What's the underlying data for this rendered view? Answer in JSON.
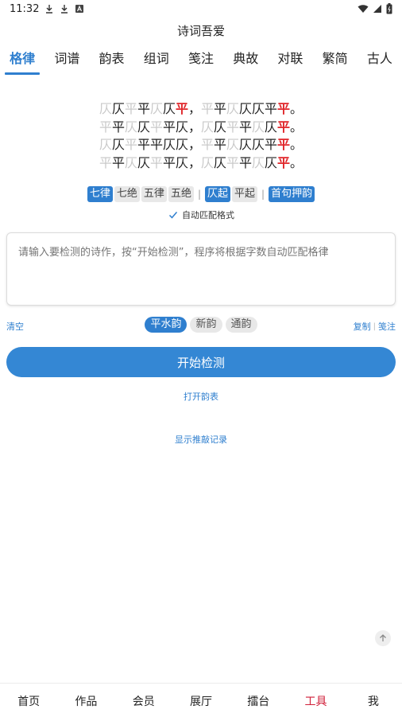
{
  "status_bar": {
    "time": "11:32",
    "icons": [
      "download-icon",
      "download-icon",
      "a-icon"
    ],
    "right_icons": [
      "wifi-icon",
      "signal-icon",
      "battery-icon"
    ]
  },
  "app": {
    "title": "诗词吾爱"
  },
  "tabs": [
    {
      "label": "格律",
      "active": true
    },
    {
      "label": "词谱"
    },
    {
      "label": "韵表"
    },
    {
      "label": "组词"
    },
    {
      "label": "笺注"
    },
    {
      "label": "典故"
    },
    {
      "label": "对联"
    },
    {
      "label": "繁简"
    },
    {
      "label": "古人"
    }
  ],
  "patterns": {
    "lines": [
      [
        [
          "仄",
          "f"
        ],
        [
          "仄",
          "d"
        ],
        [
          "平",
          "f"
        ],
        [
          "平",
          "d"
        ],
        [
          "仄",
          "f"
        ],
        [
          "仄",
          "d"
        ],
        [
          "平",
          "r"
        ],
        [
          "，",
          "p"
        ],
        [
          "平",
          "f"
        ],
        [
          "平",
          "d"
        ],
        [
          "仄",
          "f"
        ],
        [
          "仄",
          "d"
        ],
        [
          "仄",
          "d"
        ],
        [
          "平",
          "d"
        ],
        [
          "平",
          "r"
        ],
        [
          "。",
          "p"
        ]
      ],
      [
        [
          "平",
          "f"
        ],
        [
          "平",
          "d"
        ],
        [
          "仄",
          "f"
        ],
        [
          "仄",
          "d"
        ],
        [
          "平",
          "f"
        ],
        [
          "平",
          "d"
        ],
        [
          "仄",
          "d"
        ],
        [
          "，",
          "p"
        ],
        [
          "仄",
          "f"
        ],
        [
          "仄",
          "d"
        ],
        [
          "平",
          "f"
        ],
        [
          "平",
          "d"
        ],
        [
          "仄",
          "f"
        ],
        [
          "仄",
          "d"
        ],
        [
          "平",
          "r"
        ],
        [
          "。",
          "p"
        ]
      ],
      [
        [
          "仄",
          "f"
        ],
        [
          "仄",
          "d"
        ],
        [
          "平",
          "f"
        ],
        [
          "平",
          "d"
        ],
        [
          "平",
          "d"
        ],
        [
          "仄",
          "d"
        ],
        [
          "仄",
          "d"
        ],
        [
          "，",
          "p"
        ],
        [
          "平",
          "f"
        ],
        [
          "平",
          "d"
        ],
        [
          "仄",
          "f"
        ],
        [
          "仄",
          "d"
        ],
        [
          "仄",
          "d"
        ],
        [
          "平",
          "d"
        ],
        [
          "平",
          "r"
        ],
        [
          "。",
          "p"
        ]
      ],
      [
        [
          "平",
          "f"
        ],
        [
          "平",
          "d"
        ],
        [
          "仄",
          "f"
        ],
        [
          "仄",
          "d"
        ],
        [
          "平",
          "f"
        ],
        [
          "平",
          "d"
        ],
        [
          "仄",
          "d"
        ],
        [
          "，",
          "p"
        ],
        [
          "仄",
          "f"
        ],
        [
          "仄",
          "d"
        ],
        [
          "平",
          "f"
        ],
        [
          "平",
          "d"
        ],
        [
          "仄",
          "f"
        ],
        [
          "仄",
          "d"
        ],
        [
          "平",
          "r"
        ],
        [
          "。",
          "p"
        ]
      ]
    ]
  },
  "format_chips": {
    "group1": [
      {
        "label": "七律",
        "selected": true
      },
      {
        "label": "七绝"
      },
      {
        "label": "五律"
      },
      {
        "label": "五绝"
      }
    ],
    "group2": [
      {
        "label": "仄起",
        "selected": true
      },
      {
        "label": "平起"
      }
    ],
    "group3": [
      {
        "label": "首句押韵",
        "selected": true
      }
    ],
    "separator": "|"
  },
  "auto_match": {
    "label": "自动匹配格式",
    "checked": true
  },
  "input": {
    "placeholder": "请输入要检测的诗作，按“开始检测”，程序将根据字数自动匹配格律",
    "value": ""
  },
  "rhyme_row": {
    "clear_label": "清空",
    "chips": [
      {
        "label": "平水韵",
        "selected": true
      },
      {
        "label": "新韵"
      },
      {
        "label": "通韵"
      }
    ],
    "copy_label": "复制",
    "divider": "|",
    "annotate_label": "笺注"
  },
  "start_button": {
    "label": "开始检测"
  },
  "open_rhyme_table": {
    "label": "打开韵表"
  },
  "show_records": {
    "label": "显示推敲记录"
  },
  "bottom_nav": [
    {
      "label": "首页"
    },
    {
      "label": "作品"
    },
    {
      "label": "会员"
    },
    {
      "label": "展厅"
    },
    {
      "label": "擂台"
    },
    {
      "label": "工具",
      "active": true
    },
    {
      "label": "我"
    }
  ],
  "colors": {
    "accent": "#2f7fcf",
    "rhyme": "#e0262a",
    "nav_active": "#d0203a"
  }
}
